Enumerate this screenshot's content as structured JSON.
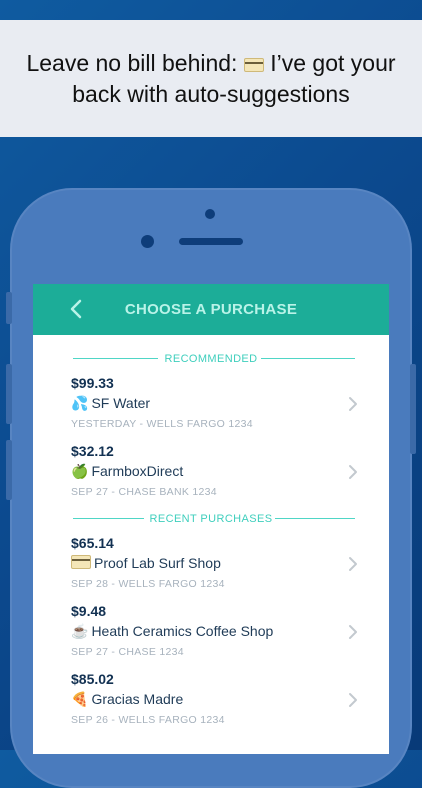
{
  "banner": {
    "line1_pre": "Leave no bill behind: ",
    "line1_post": " I’ve got your",
    "line2": "back with auto-suggestions",
    "card_icon": "credit-card-icon"
  },
  "nav": {
    "title": "CHOOSE A PURCHASE",
    "back_icon": "chevron-left-icon"
  },
  "sections": {
    "recommended": "RECOMMENDED",
    "recent": "RECENT PURCHASES"
  },
  "recommended": [
    {
      "amount": "$99.33",
      "emoji": "💦",
      "merchant": "SF Water",
      "detail": "YESTERDAY - WELLS FARGO 1234"
    },
    {
      "amount": "$32.12",
      "emoji": "🍏",
      "merchant": "FarmboxDirect",
      "detail": "SEP 27 - CHASE BANK 1234"
    }
  ],
  "recent": [
    {
      "amount": "$65.14",
      "emoji": "card",
      "merchant": "Proof Lab Surf Shop",
      "detail": "SEP 28 - WELLS FARGO 1234"
    },
    {
      "amount": "$9.48",
      "emoji": "☕",
      "merchant": "Heath Ceramics Coffee Shop",
      "detail": "SEP 27 - CHASE 1234"
    },
    {
      "amount": "$85.02",
      "emoji": "🍕",
      "merchant": "Gracias Madre",
      "detail": "SEP 26 - WELLS FARGO 1234"
    }
  ],
  "colors": {
    "background": "#0c4a8f",
    "nav": "#1cad98",
    "accent": "#3fcfbd"
  }
}
